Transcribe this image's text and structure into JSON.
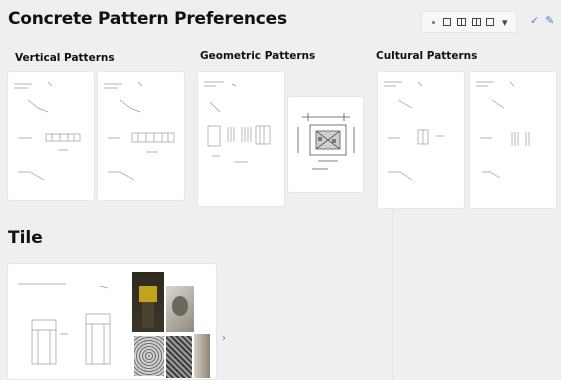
{
  "page": {
    "title": "Concrete Pattern Preferences"
  },
  "toolbar": {
    "icons": [
      "dot",
      "frame-icon",
      "grid-icon",
      "columns-icon",
      "layout-icon",
      "chevron-down-icon"
    ],
    "right_icons": [
      "check-icon",
      "pen-icon"
    ],
    "accent": "#4a7ce0",
    "chevron": "▾",
    "check": "✓",
    "pen": "✎"
  },
  "sections": [
    {
      "id": "vertical",
      "label": "Vertical Patterns"
    },
    {
      "id": "geometric",
      "label": "Geometric Patterns"
    },
    {
      "id": "cultural",
      "label": "Cultural Patterns"
    }
  ],
  "tile": {
    "label": "Tile",
    "more_glyph": "›"
  },
  "colors": {
    "background": "#efefef",
    "card": "#ffffff",
    "drawing_line": "#9a9a9a",
    "photo_dark": "#3a3628",
    "photo_yellow": "#c4a21e"
  }
}
